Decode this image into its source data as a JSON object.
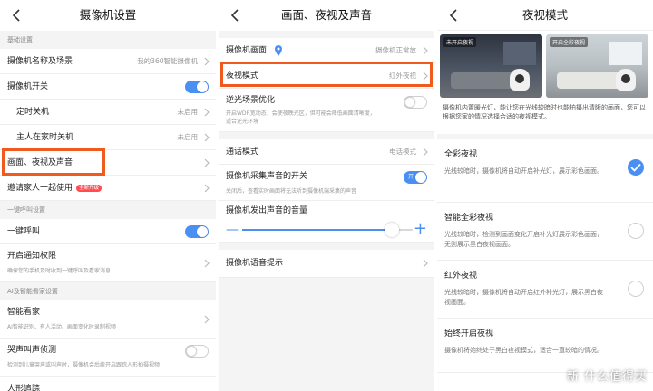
{
  "panel1": {
    "title": "摄像机设置",
    "section_basic": "基础设置",
    "name_row": {
      "label": "摄像机名称及场景",
      "value": "我的360智能摄像机"
    },
    "switch_row": {
      "label": "摄像机开关",
      "on": true
    },
    "timer_row": {
      "label": "定时关机",
      "value": "未启用"
    },
    "home_row": {
      "label": "主人在家时关机",
      "value": "未启用"
    },
    "picture_row": {
      "label": "画面、夜视及声音"
    },
    "invite_row": {
      "label": "邀请家人一起使用",
      "badge": "全新升级"
    },
    "section_call": "一键呼叫设置",
    "call_row": {
      "label": "一键呼叫",
      "on": true
    },
    "notify_row": {
      "label": "开启通知权限",
      "sub": "确保您的手机及时收到一键呼叫及看家消息"
    },
    "section_ai": "AI及智能看家设置",
    "smart_row": {
      "label": "智能看家",
      "sub": "AI智能识别、有人活动、画面变化时录制视频"
    },
    "cry_row": {
      "label": "哭声叫声侦测",
      "sub": "检测到儿童哭声或叫声时，摄像机会后续开启跟踪人形拍摄视频",
      "on": false
    },
    "bottom_row": {
      "label": "人形追踪"
    }
  },
  "panel2": {
    "title": "画面、夜视及声音",
    "view_row": {
      "label": "摄像机画面",
      "value": "摄像机正常放"
    },
    "night_row": {
      "label": "夜视模式",
      "value": "红外夜视"
    },
    "wdr_row": {
      "label": "逆光场景优化",
      "sub1": "开启WDR宽动态，会使夜晚光区，但可能会降低画面清晰度，",
      "sub2": "适合逆光环境",
      "on": false
    },
    "talk_row": {
      "label": "通话模式",
      "value": "电话模式"
    },
    "capture_row": {
      "label": "摄像机采集声音的开关",
      "sub": "关闭后，查看实时画面将无法听到摄像机端采集的声音",
      "on": true,
      "on_text": "开"
    },
    "volume_row": {
      "label": "摄像机发出声音的音量",
      "level_percent": 88
    },
    "voice_row": {
      "label": "摄像机语音提示"
    }
  },
  "panel3": {
    "title": "夜视模式",
    "img_a_label": "未开启夜视",
    "img_b_label": "开启全彩夜视",
    "desc": "摄像机内置暖光灯，能让您在光线较暗时也能拍摄出清晰的画面，您可以根据您家的情况选择合适的夜视模式。",
    "modes": [
      {
        "title": "全彩夜视",
        "desc": "光线较暗时，摄像机将自动开启补光灯，展示彩色画面。",
        "selected": true
      },
      {
        "title": "智能全彩夜视",
        "desc": "光线较暗时，检测到画面变化开启补光灯展示彩色画面，无则展示黑白夜视画面。",
        "selected": false
      },
      {
        "title": "红外夜视",
        "desc": "光线较暗时，摄像机将自动开启红外补光灯，展示黑白夜视画面。",
        "selected": false
      },
      {
        "title": "始终开启夜视",
        "desc": "摄像机将始终处于黑白夜视模式，适合一直较暗的情况。",
        "selected": false
      }
    ],
    "watermark": "新 什么值得买"
  },
  "colors": {
    "accent": "#4a8ff2",
    "highlight": "#f05a1e"
  },
  "icons": {
    "back": "chevron-left-icon",
    "chevron": "chevron-right-icon",
    "location": "location-pin-icon",
    "check": "check-icon"
  }
}
